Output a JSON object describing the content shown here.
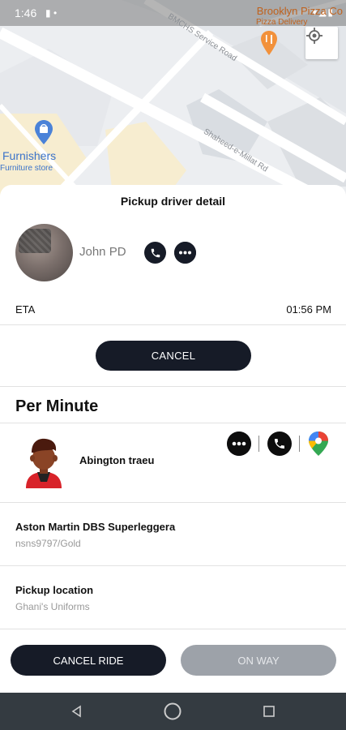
{
  "status_bar": {
    "time": "1:46"
  },
  "map": {
    "poi_brooklyn": "Brooklyn Pizza Co",
    "poi_pizza_delivery": "Pizza Delivery",
    "road_1": "BMCHS Service Road",
    "road_2": "Shaheed-e-Millat Rd",
    "poi_furnishers": "Furnishers",
    "poi_furniture_store": "Furniture store",
    "icons": [
      "locate-me-icon",
      "restaurant-pin-icon",
      "shopping-pin-icon"
    ]
  },
  "sheet": {
    "title": "Pickup driver detail",
    "driver_name": "John PD",
    "eta_label": "ETA",
    "eta_value": "01:56 PM",
    "cancel_label": "CANCEL",
    "fare_type": "Per Minute",
    "rider_name": "Abington traeu",
    "car_name": "Aston Martin DBS Superleggera",
    "car_plate": "nsns9797/Gold",
    "pickup_label": "Pickup location",
    "pickup_value": "Ghani's Uniforms",
    "cancel_ride_label": "CANCEL RIDE",
    "on_way_label": "ON WAY"
  },
  "colors": {
    "primary_dark": "#161b27",
    "disabled": "#9da2a9",
    "nav_bar": "#343b41",
    "map_link": "#3b73c9"
  }
}
